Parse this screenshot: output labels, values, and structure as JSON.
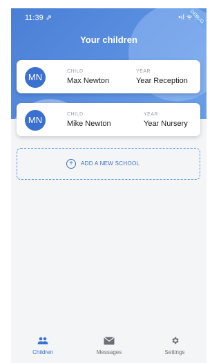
{
  "status_bar": {
    "time": "11:39 ⇗",
    "icons": "•ıl ᯤ ▮",
    "ribbon": "DEBUG"
  },
  "header": {
    "title": "Your children"
  },
  "children": [
    {
      "initials": "MN",
      "child_label": "CHILD",
      "name": "Max Newton",
      "year_label": "YEAR",
      "year": "Year Reception"
    },
    {
      "initials": "MN",
      "child_label": "CHILD",
      "name": "Mike Newton",
      "year_label": "YEAR",
      "year": "Year Nursery"
    }
  ],
  "add_school": {
    "label": "ADD A NEW SCHOOL",
    "icon": "plus-circle-icon"
  },
  "nav": {
    "items": [
      {
        "label": "Children",
        "icon": "people-icon",
        "active": true
      },
      {
        "label": "Messages",
        "icon": "envelope-icon",
        "active": false
      },
      {
        "label": "Settings",
        "icon": "gear-icon",
        "active": false
      }
    ]
  },
  "colors": {
    "accent": "#3a70cf",
    "header": "#4a7fd6",
    "background": "#f4f5f7"
  }
}
